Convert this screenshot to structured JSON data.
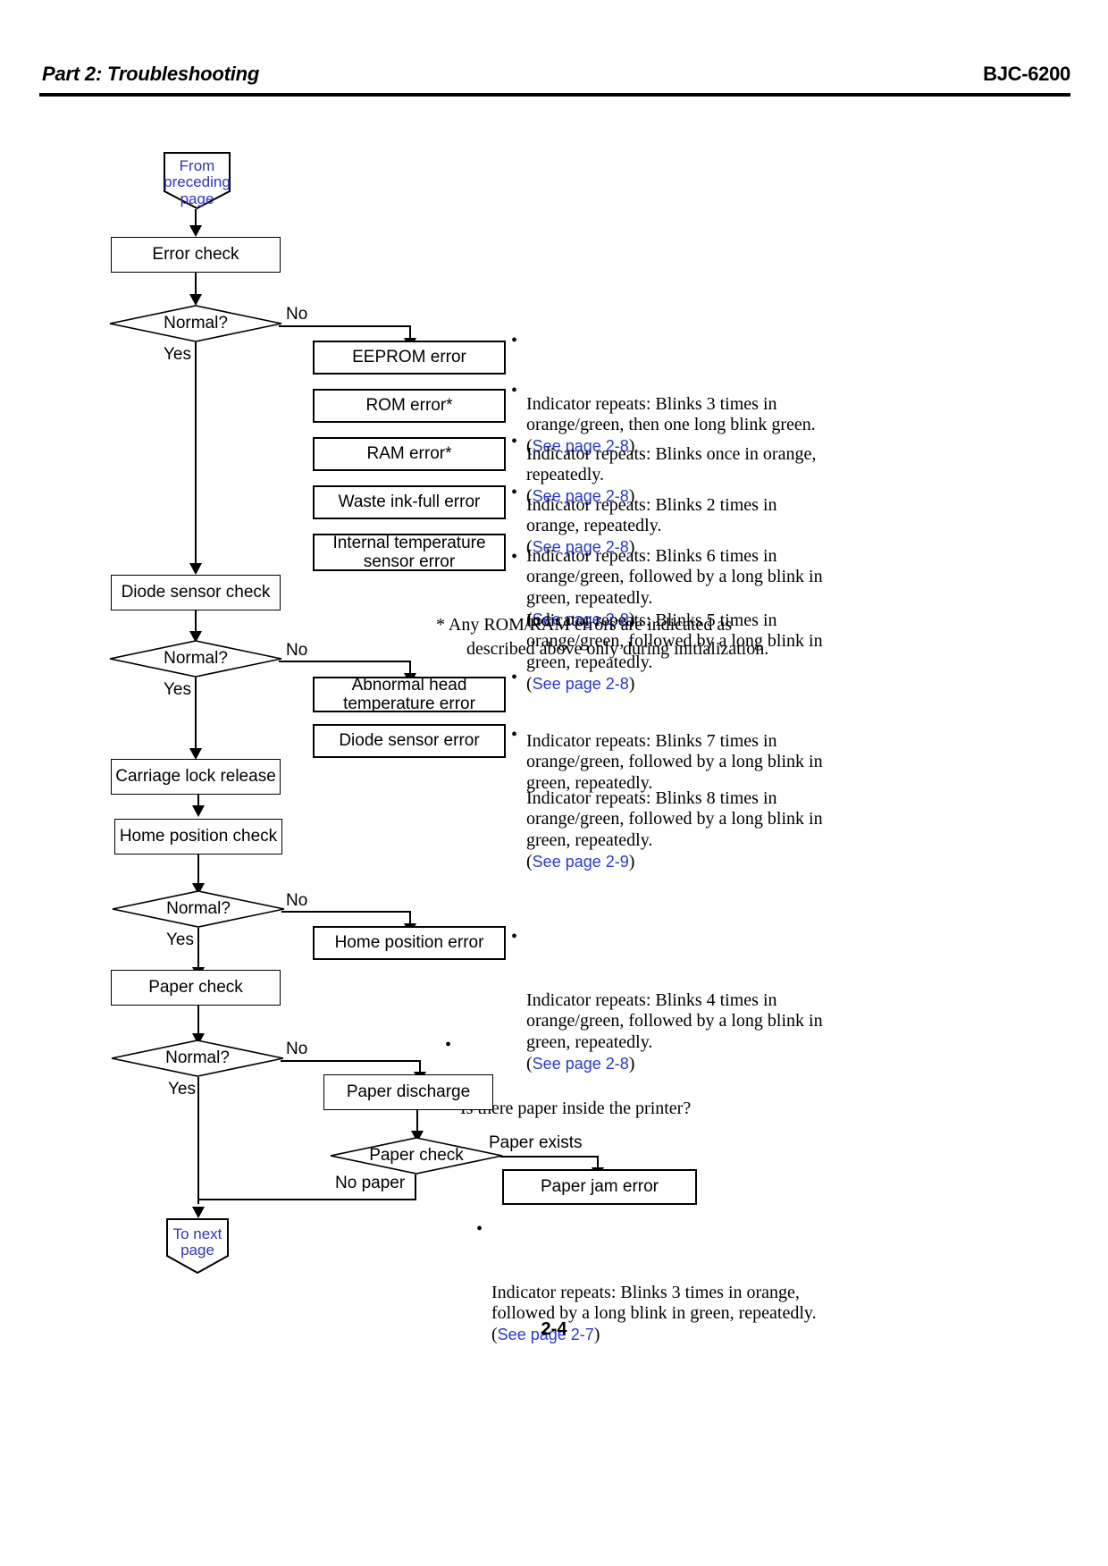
{
  "header": {
    "left_title": "Part 2: Troubleshooting",
    "right_title": "BJC-6200"
  },
  "footer": {
    "page_number": "2-4"
  },
  "connectors": {
    "from_preceding": "From\npreceding\npage",
    "to_next": "To next\npage"
  },
  "flow": {
    "error_check": "Error check",
    "normal_1": "Normal?",
    "diode_sensor_check": "Diode sensor check",
    "normal_2": "Normal?",
    "carriage_lock_release": "Carriage lock release",
    "home_position_check": "Home position check",
    "normal_3": "Normal?",
    "paper_check_proc": "Paper check",
    "normal_4": "Normal?",
    "paper_discharge": "Paper discharge",
    "paper_check_decision": "Paper check",
    "paper_jam_error": "Paper jam error"
  },
  "edges": {
    "no_1": "No",
    "yes_1": "Yes",
    "no_2": "No",
    "yes_2": "Yes",
    "no_3": "No",
    "yes_3": "Yes",
    "no_4": "No",
    "yes_4": "Yes",
    "paper_exists": "Paper exists",
    "no_paper": "No paper"
  },
  "error_boxes": {
    "eeprom": "EEPROM error",
    "rom": "ROM error*",
    "ram": "RAM error*",
    "waste_ink": "Waste ink-full error",
    "internal_temp": "Internal temperature\nsensor error",
    "abnormal_head_temp": "Abnormal head\ntemperature error",
    "diode_sensor_error": "Diode sensor error",
    "home_position_error": "Home position error"
  },
  "notes": {
    "eeprom": {
      "text": "Indicator repeats: Blinks 3 times in\norange/green, then one long blink green.",
      "ref": "See page 2-8"
    },
    "rom": {
      "text": "Indicator repeats: Blinks once in orange,\nrepeatedly.",
      "ref": "See page 2-8"
    },
    "ram": {
      "text": "Indicator repeats: Blinks 2 times in\norange, repeatedly.",
      "ref": "See page 2-8"
    },
    "waste_ink": {
      "text": "Indicator repeats: Blinks 6 times in\norange/green, followed by a long blink in\ngreen, repeatedly.",
      "ref": "See page 2-8"
    },
    "internal_temp": {
      "text": "Indicator repeats: Blinks 5 times in\norange/green, followed by a long blink in\ngreen, repeatedly.",
      "ref": "See page 2-8"
    },
    "abnormal_head_temp": {
      "text": "Indicator repeats: Blinks 7 times in\norange/green, followed by a long blink in\ngreen, repeatedly.",
      "ref": ""
    },
    "diode_sensor": {
      "text": "Indicator repeats: Blinks 8 times in\norange/green, followed by a long blink in\ngreen, repeatedly.",
      "ref": "See page 2-9"
    },
    "home_position": {
      "text": "Indicator repeats: Blinks 4 times in\norange/green, followed by a long blink in\ngreen, repeatedly.",
      "ref": "See page 2-8"
    },
    "paper_question": {
      "text": "Is there paper inside the printer?",
      "ref": ""
    },
    "paper_jam": {
      "text": "Indicator repeats: Blinks 3 times in orange,\nfollowed by a long blink in green, repeatedly.",
      "ref": "See page 2-7"
    },
    "footnote_rom_ram": {
      "line1": "* Any ROM/RAM errors are indicated as",
      "line2": "described above only during initialization."
    }
  },
  "colors": {
    "link": "#2a39c9",
    "connector_text": "#3333bb",
    "line": "#000000"
  }
}
